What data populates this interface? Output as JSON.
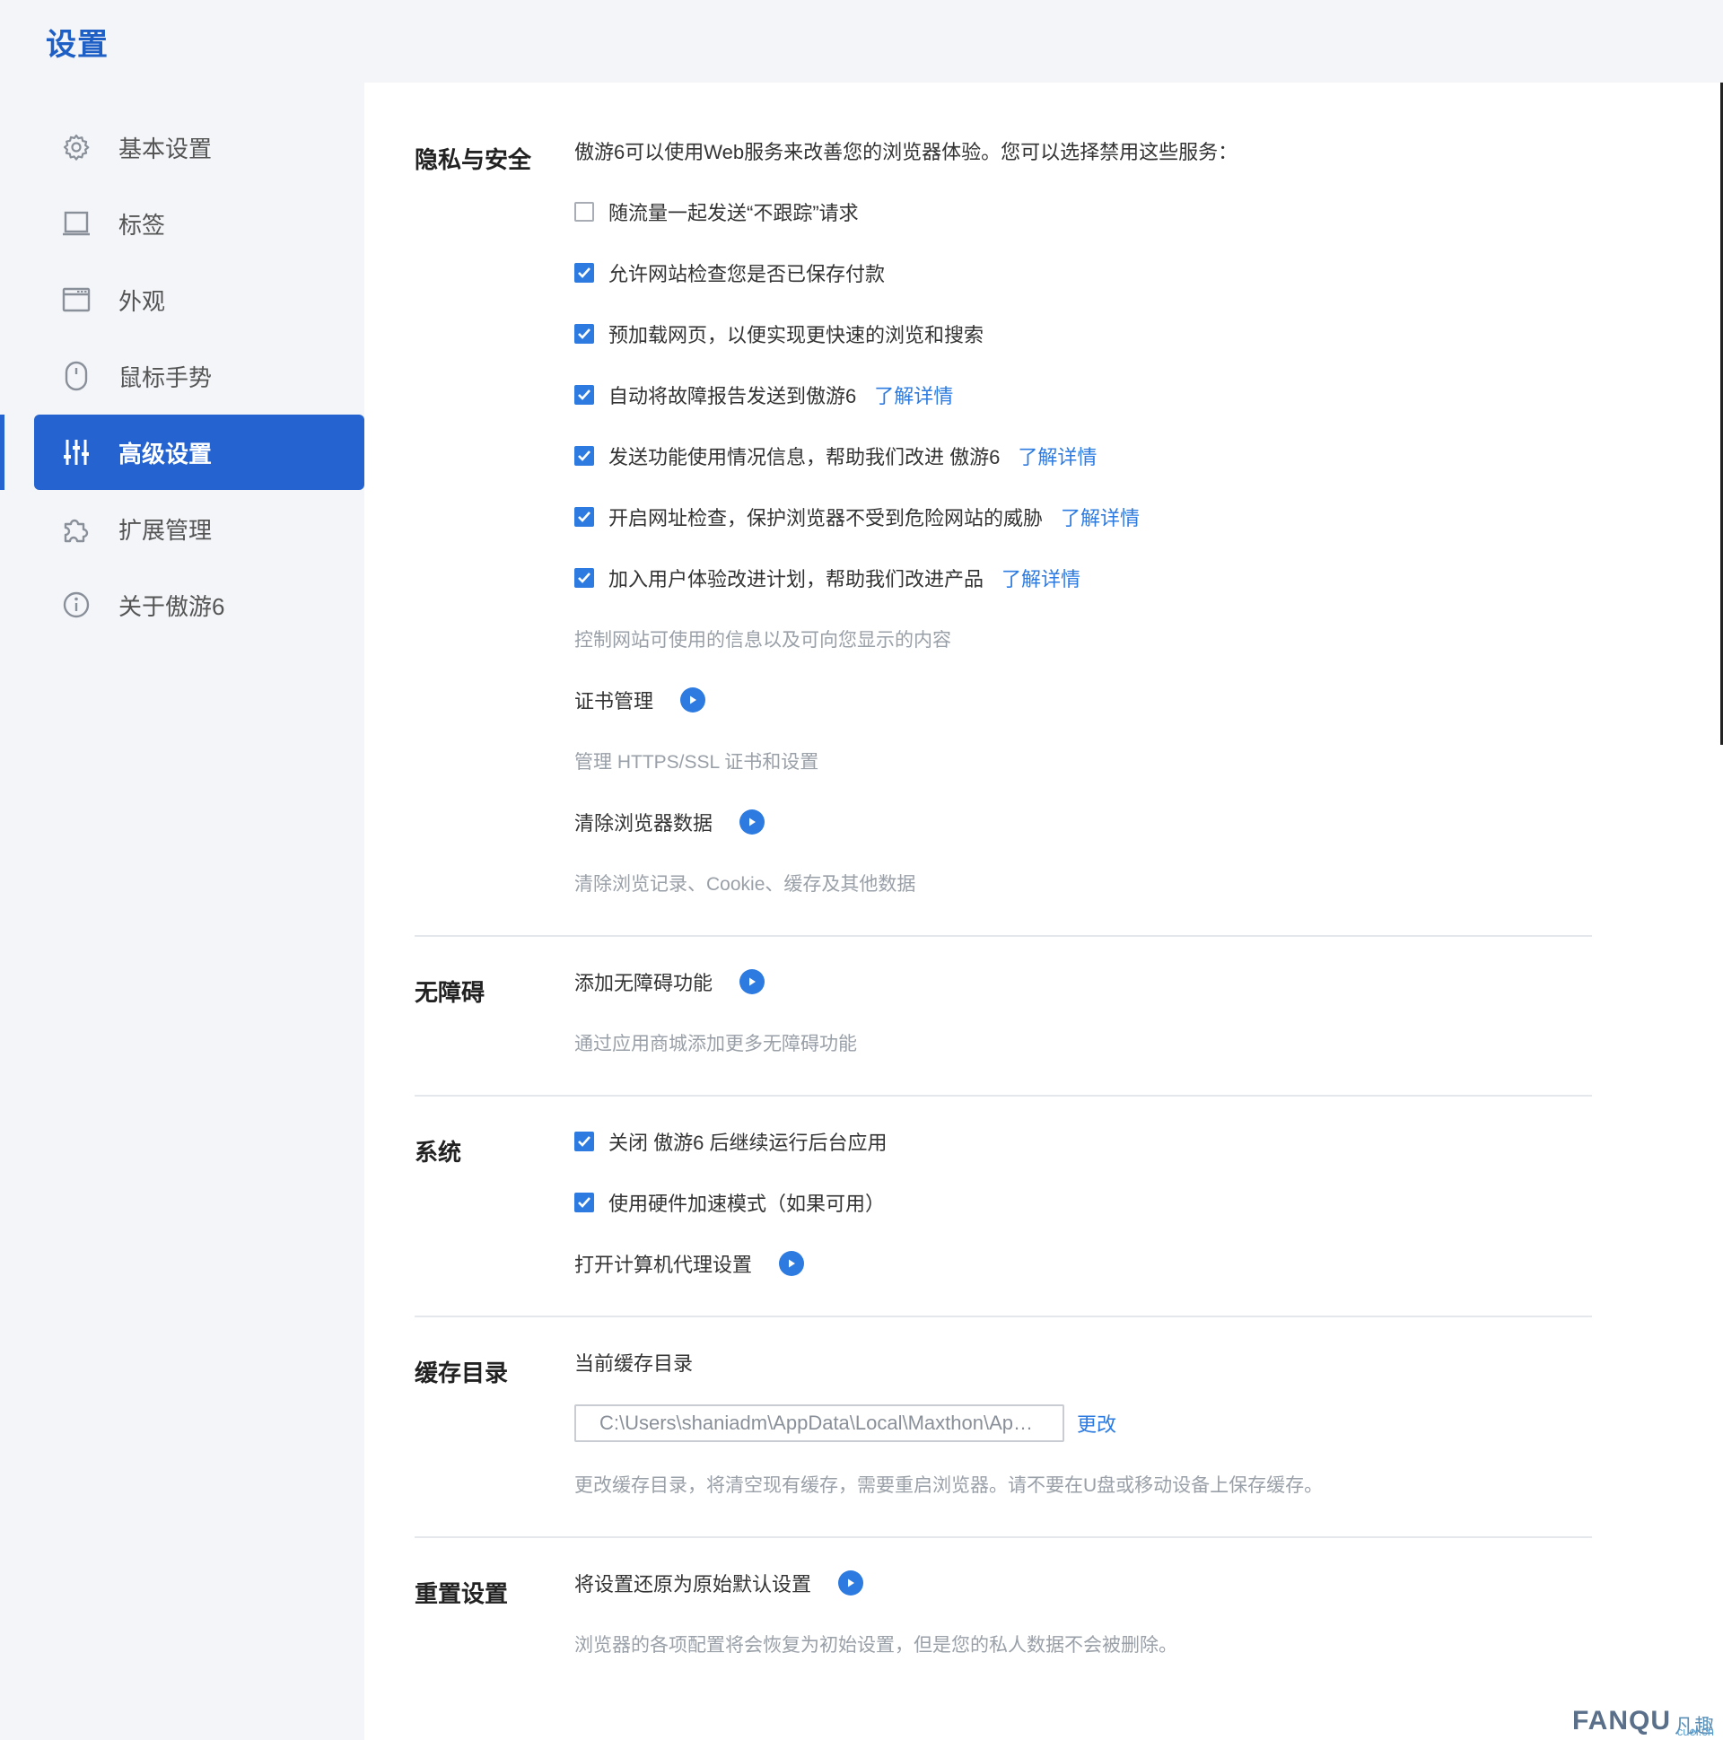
{
  "header": {
    "title": "设置"
  },
  "sidebar": {
    "items": [
      {
        "label": "基本设置",
        "icon": "gear-icon",
        "active": false
      },
      {
        "label": "标签",
        "icon": "tab-icon",
        "active": false
      },
      {
        "label": "外观",
        "icon": "window-icon",
        "active": false
      },
      {
        "label": "鼠标手势",
        "icon": "mouse-icon",
        "active": false
      },
      {
        "label": "高级设置",
        "icon": "sliders-icon",
        "active": true
      },
      {
        "label": "扩展管理",
        "icon": "puzzle-icon",
        "active": false
      },
      {
        "label": "关于傲游6",
        "icon": "info-icon",
        "active": false
      }
    ]
  },
  "privacy": {
    "title": "隐私与安全",
    "intro": "傲游6可以使用Web服务来改善您的浏览器体验。您可以选择禁用这些服务：",
    "options": [
      {
        "label": "随流量一起发送“不跟踪”请求",
        "checked": false,
        "link": ""
      },
      {
        "label": "允许网站检查您是否已保存付款",
        "checked": true,
        "link": ""
      },
      {
        "label": "预加载网页，以便实现更快速的浏览和搜索",
        "checked": true,
        "link": ""
      },
      {
        "label": "自动将故障报告发送到傲游6",
        "checked": true,
        "link": "了解详情"
      },
      {
        "label": "发送功能使用情况信息，帮助我们改进 傲游6",
        "checked": true,
        "link": "了解详情"
      },
      {
        "label": "开启网址检查，保护浏览器不受到危险网站的威胁",
        "checked": true,
        "link": "了解详情"
      },
      {
        "label": "加入用户体验改进计划，帮助我们改进产品",
        "checked": true,
        "link": "了解详情"
      }
    ],
    "site_info": "控制网站可使用的信息以及可向您显示的内容",
    "cert_label": "证书管理",
    "cert_desc": "管理 HTTPS/SSL 证书和设置",
    "clear_label": "清除浏览器数据",
    "clear_desc": "清除浏览记录、Cookie、缓存及其他数据"
  },
  "accessibility": {
    "title": "无障碍",
    "add_label": "添加无障碍功能",
    "add_desc": "通过应用商城添加更多无障碍功能"
  },
  "system": {
    "title": "系统",
    "opt1": {
      "label": "关闭 傲游6 后继续运行后台应用",
      "checked": true
    },
    "opt2": {
      "label": "使用硬件加速模式（如果可用）",
      "checked": true
    },
    "proxy_label": "打开计算机代理设置"
  },
  "cache": {
    "title": "缓存目录",
    "current_label": "当前缓存目录",
    "path": "C:\\Users\\shaniadm\\AppData\\Local\\Maxthon\\Application\\User Data",
    "change": "更改",
    "desc": "更改缓存目录，将清空现有缓存，需要重启浏览器。请不要在U盘或移动设备上保存缓存。"
  },
  "reset": {
    "title": "重置设置",
    "label": "将设置还原为原始默认设置",
    "desc": "浏览器的各项配置将会恢复为初始设置，但是您的私人数据不会被删除。"
  },
  "watermark": {
    "main": "FANQU",
    "cn": "凡趣",
    "sub": "cuel.cn"
  },
  "colors": {
    "accent": "#2563d1",
    "checkbox": "#2d7be0",
    "title": "#1e5fc6"
  }
}
